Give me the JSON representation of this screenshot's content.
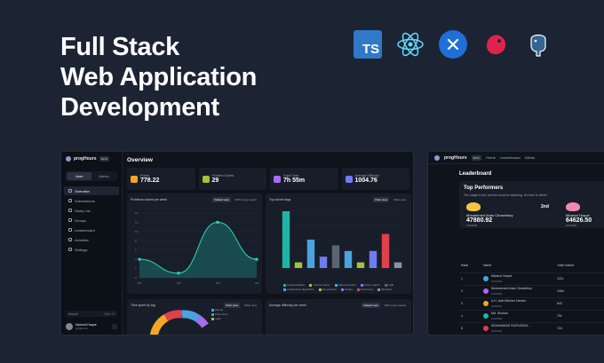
{
  "hero": {
    "line1": "Full Stack",
    "line2": "Web Application",
    "line3": "Development"
  },
  "tech_logos": [
    "typescript-logo",
    "react-logo",
    "dotnet-logo",
    "nestjs-logo",
    "postgresql-logo"
  ],
  "ts_label": "TS",
  "app": {
    "brand": "progHours",
    "beta": "BETA",
    "roles": [
      "User",
      "Admin"
    ],
    "nav": [
      "Overview",
      "Submissions",
      "Study List",
      "Groups",
      "Leaderboard",
      "Activities",
      "Settings"
    ],
    "search_placeholder": "Search",
    "search_shortcut": "Ctrl + K",
    "user_name": "Mahmul Haque",
    "user_handle": "@Mahmul",
    "page_title": "Overview",
    "stats": [
      {
        "label": "Points",
        "value": "778.22",
        "color": "#f5a524"
      },
      {
        "label": "Problem Solved",
        "value": "29",
        "color": "#a3c23b"
      },
      {
        "label": "Solve Time",
        "value": "7h 55m",
        "color": "#a86cf0"
      },
      {
        "label": "Average Difficulty",
        "value": "1004.76",
        "color": "#6f7cf0"
      }
    ],
    "problems_panel": {
      "title": "Problems solved per week",
      "btn_default": "Default view",
      "btn_empty": "With empty weeks",
      "y_ticks": [
        "14",
        "12",
        "10",
        "8",
        "6",
        "4",
        "2",
        "0"
      ],
      "x_ticks": [
        "W1",
        "W2",
        "W3",
        "W4"
      ]
    },
    "tags_panel": {
      "title": "Top solved tags",
      "btn_chart": "Chart view",
      "btn_table": "Table view",
      "legend": [
        "implementation",
        "number theory",
        "data structures",
        "binary search",
        "math",
        "constructive algorithms",
        "two pointers",
        "strings",
        "brute force",
        "bitmasks"
      ]
    },
    "time_panel": {
      "title": "Time spent by tag",
      "btn_chart": "Chart view",
      "btn_table": "Table view",
      "legend": [
        "greedy",
        "brute force",
        "math"
      ]
    },
    "diff_panel": {
      "title": "Average difficulty per week",
      "btn_default": "Default view",
      "btn_empty": "With empty weeks"
    },
    "chart_data": [
      {
        "type": "area",
        "title": "Problems solved per week",
        "categories": [
          "W1",
          "W2",
          "W3",
          "W4"
        ],
        "values": [
          4,
          1,
          12,
          4
        ],
        "ylim": [
          0,
          14
        ]
      },
      {
        "type": "bar",
        "title": "Top solved tags",
        "categories": [
          "implementation",
          "number theory",
          "data structures",
          "binary search",
          "math",
          "constructive algorithms",
          "two pointers",
          "strings",
          "brute force",
          "bitmasks"
        ],
        "values": [
          10,
          1,
          5,
          2,
          4,
          3,
          1,
          3,
          6,
          1
        ],
        "colors": [
          "#1fb5a5",
          "#a3c23b",
          "#4aa3df",
          "#6f7cf0",
          "#5b6472",
          "#4aa3df",
          "#a3c23b",
          "#6f7cf0",
          "#e0404a",
          "#8a93a3"
        ]
      }
    ]
  },
  "leaderboard": {
    "nav": [
      "Home",
      "Leaderboard",
      "Github"
    ],
    "title": "Leaderboard",
    "top_title": "Top Performers",
    "top_sub": "The stage is set, and the world is watching. It's time to shine!",
    "top": [
      {
        "name": "Mohammed Anas Chowdhury",
        "score": "47880.92",
        "handle": "C221064",
        "rank": ""
      },
      {
        "name": "Mizanul Hoque",
        "score": "64626.50",
        "handle": "C221091",
        "rank": "2nd"
      }
    ],
    "headers": [
      "Rank",
      "Name",
      "Total Solved"
    ],
    "rows": [
      {
        "rank": "1",
        "name": "Mizanul Hoque",
        "handle": "C221091",
        "solved": "1211"
      },
      {
        "rank": "2",
        "name": "Mohammed Anas Chowdhury",
        "handle": "C221064",
        "solved": "1084"
      },
      {
        "rank": "3",
        "name": "A.H. Asib Iftekher Hamim",
        "handle": "C221071",
        "solved": "843"
      },
      {
        "rank": "4",
        "name": "Md. Shohan",
        "handle": "C221094",
        "solved": "751"
      },
      {
        "rank": "5",
        "name": "MOHAMMAD SAIFUDDIN...",
        "handle": "C221002",
        "solved": "724"
      }
    ]
  }
}
